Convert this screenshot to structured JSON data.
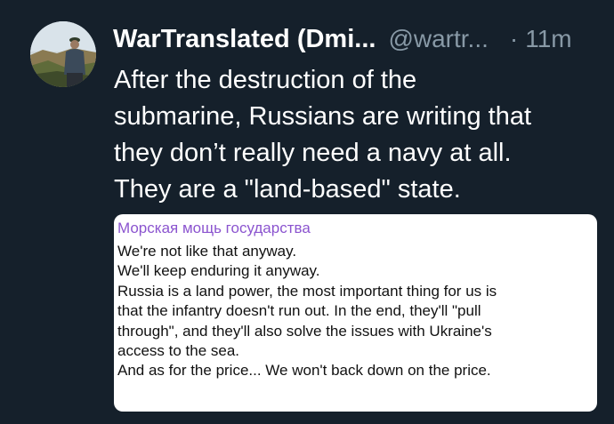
{
  "tweet": {
    "author": {
      "display_name": "WarTranslated (Dmi...",
      "handle": "@wartr...",
      "avatar": "profile-photo"
    },
    "separator": "·",
    "time": "11m",
    "text_lines": [
      "After the destruction of the",
      "submarine, Russians are writing that",
      "they don’t really need a navy at all.",
      "They are a \"land-based\" state."
    ],
    "attached_image": {
      "title": "Морская мощь государства",
      "lines": [
        "We're not like that anyway.",
        "We'll keep enduring it anyway.",
        "Russia is a land power, the most important thing for us is",
        "that the infantry doesn't run out. In the end, they'll \"pull",
        "through\", and they'll also solve the issues with Ukraine's",
        "access to the sea.",
        "And as for the price... We won't back down on the price."
      ]
    }
  },
  "colors": {
    "background": "#15202b",
    "primary_text": "#ffffff",
    "secondary_text": "#8899a6",
    "card_title": "#8b54cf"
  }
}
